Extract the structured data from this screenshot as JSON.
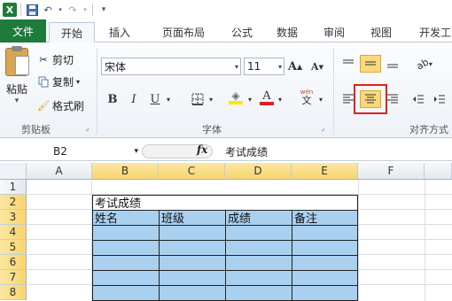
{
  "quick_access": {
    "icons": [
      "excel-logo-icon",
      "save-icon",
      "undo-icon",
      "redo-icon",
      "customize-icon"
    ]
  },
  "tabs": [
    {
      "label": "文件",
      "active": false
    },
    {
      "label": "开始",
      "active": true
    },
    {
      "label": "插入",
      "active": false
    },
    {
      "label": "页面布局",
      "active": false
    },
    {
      "label": "公式",
      "active": false
    },
    {
      "label": "数据",
      "active": false
    },
    {
      "label": "审阅",
      "active": false
    },
    {
      "label": "视图",
      "active": false
    },
    {
      "label": "开发工",
      "active": false
    }
  ],
  "ribbon": {
    "clipboard": {
      "paste_label": "粘贴",
      "cut_label": "剪切",
      "copy_label": "复制",
      "format_painter_label": "格式刷",
      "group_label": "剪贴板"
    },
    "font": {
      "font_name": "宋体",
      "font_size": "11",
      "bold": "B",
      "italic": "I",
      "underline": "U",
      "grow": "A",
      "shrink": "A",
      "phonetic": "wén",
      "color_a": "A",
      "group_label": "字体"
    },
    "alignment": {
      "group_label": "对齐方式"
    },
    "colors": {
      "file_tab": "#1e7b3c",
      "highlight": "#fbd979",
      "selection_fill": "#a9d0ef",
      "callout_border": "#e02020",
      "font_color_bar": "#e02020",
      "fill_color_bar": "#ffe600"
    }
  },
  "formula_bar": {
    "name_box": "B2",
    "fx": "fx",
    "content": "考试成绩"
  },
  "sheet": {
    "columns": [
      "A",
      "B",
      "C",
      "D",
      "E",
      "F"
    ],
    "selected_columns": [
      "B",
      "C",
      "D",
      "E"
    ],
    "rows": [
      "1",
      "2",
      "3",
      "4",
      "5",
      "6",
      "7",
      "8"
    ],
    "selected_rows": [
      "2",
      "3",
      "4",
      "5",
      "6",
      "7",
      "8"
    ],
    "cells": {
      "B2": "考试成绩",
      "B3": "姓名",
      "C3": "班级",
      "D3": "成绩",
      "E3": "备注"
    }
  }
}
